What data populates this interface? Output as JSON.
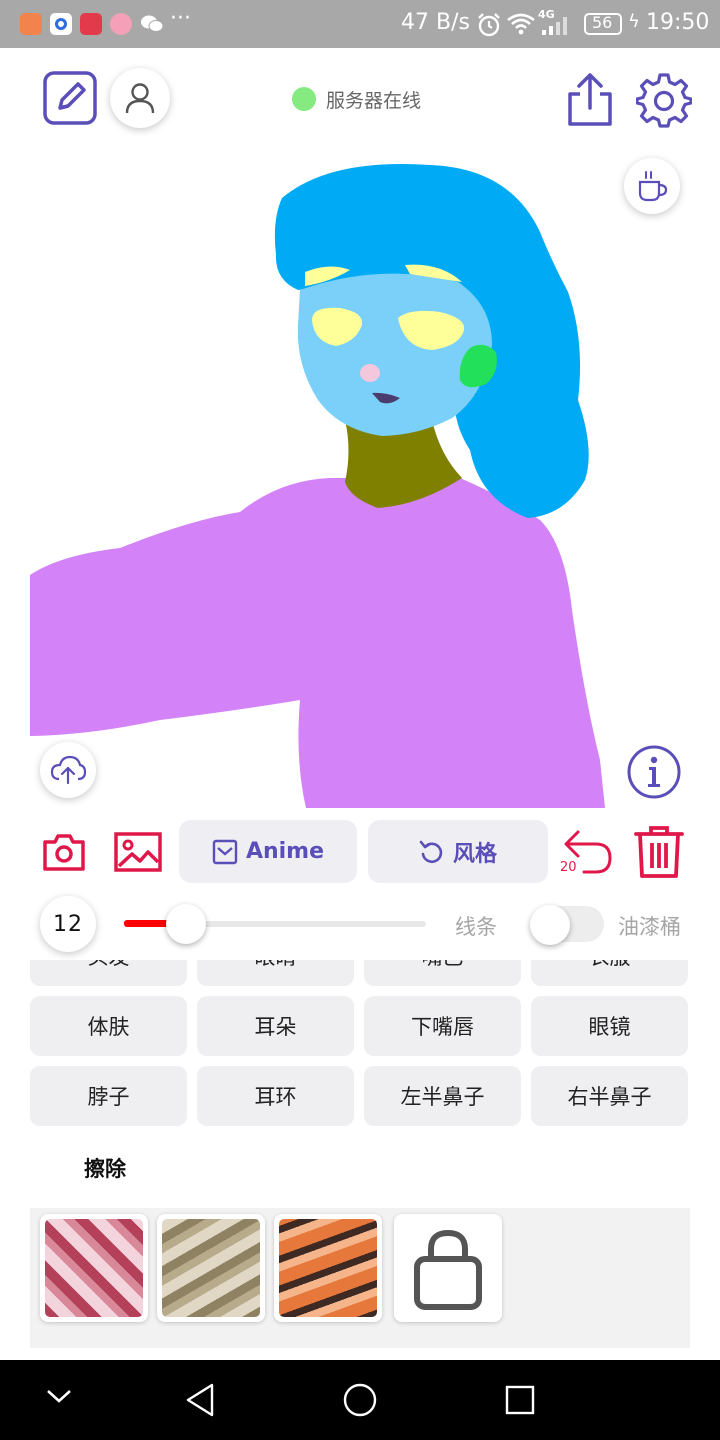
{
  "status_bar": {
    "network_speed": "47 B/s",
    "signal": "4G",
    "battery": "56",
    "time": "19:50",
    "more": "···"
  },
  "toolbar": {
    "server_status": "服务器在线",
    "server_status_color": "#85ea7f",
    "accent_color": "#5a4fb8"
  },
  "tools": {
    "anime_button": "Anime",
    "style_button": "风格",
    "undo_count": "20",
    "brush_size": "12",
    "brush_size_value": 12,
    "line_label": "线条",
    "bucket_label": "油漆桶",
    "bucket_enabled": false,
    "brush_color": "#ff0000",
    "danger_color": "#e0184a"
  },
  "parts": {
    "row0": [
      "头发",
      "眼睛",
      "嘴巴",
      "衣服"
    ],
    "row1": [
      "体肤",
      "耳朵",
      "下嘴唇",
      "眼镜"
    ],
    "row2": [
      "脖子",
      "耳环",
      "左半鼻子",
      "右半鼻子"
    ],
    "erase_label": "擦除"
  },
  "styles": {
    "items": [
      {
        "name": "style-pink",
        "colors": [
          "#b5405a",
          "#f4d4dc"
        ]
      },
      {
        "name": "style-beige",
        "colors": [
          "#8e8263",
          "#e0d8c4"
        ]
      },
      {
        "name": "style-orange",
        "colors": [
          "#e5783a",
          "#3e2a22"
        ]
      }
    ],
    "shop_icon": "shopping-bag-icon"
  },
  "canvas": {
    "colors": {
      "hair": "#00aaf5",
      "skin": "#7ad0f8",
      "eyes": "#ffff99",
      "earring": "#22e05a",
      "nose": "#f3c7dc",
      "mouth": "#4a3d6e",
      "neck": "#7f7f00",
      "clothes": "#d482f8"
    }
  }
}
